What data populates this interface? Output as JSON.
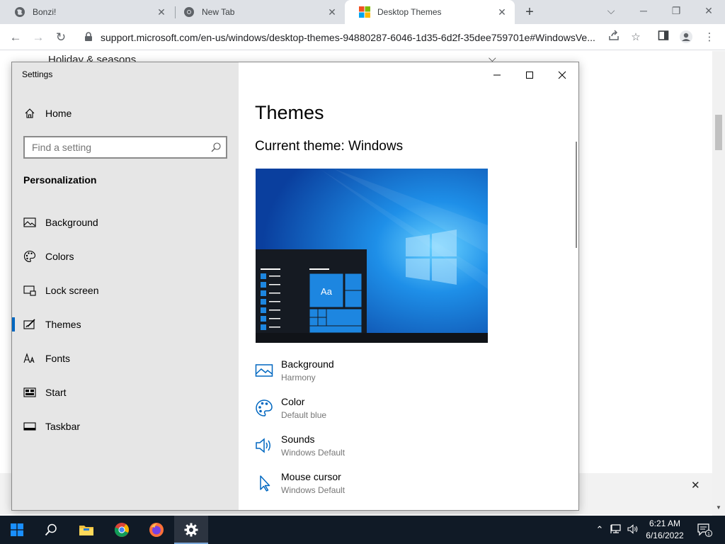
{
  "browser": {
    "tabs": [
      {
        "title": "Bonzi!",
        "icon": "globe-icon"
      },
      {
        "title": "New Tab",
        "icon": "chrome-icon"
      },
      {
        "title": "Desktop Themes",
        "icon": "microsoft-logo-icon",
        "active": true
      }
    ],
    "url": "support.microsoft.com/en-us/windows/desktop-themes-94880287-6046-1d35-6d2f-35dee759701e#WindowsVe..."
  },
  "webpage": {
    "accordion_label": "Holiday & seasons"
  },
  "settings": {
    "window_title": "Settings",
    "home_label": "Home",
    "search_placeholder": "Find a setting",
    "section_heading": "Personalization",
    "nav_items": [
      {
        "label": "Background",
        "icon": "picture-icon"
      },
      {
        "label": "Colors",
        "icon": "palette-icon"
      },
      {
        "label": "Lock screen",
        "icon": "lock-screen-icon"
      },
      {
        "label": "Themes",
        "icon": "paintbrush-icon",
        "selected": true
      },
      {
        "label": "Fonts",
        "icon": "fonts-icon"
      },
      {
        "label": "Start",
        "icon": "start-icon"
      },
      {
        "label": "Taskbar",
        "icon": "taskbar-icon"
      }
    ],
    "content": {
      "title": "Themes",
      "current_theme": "Current theme: Windows",
      "preview_tile_text": "Aa",
      "properties": [
        {
          "label": "Background",
          "value": "Harmony",
          "icon": "picture-icon"
        },
        {
          "label": "Color",
          "value": "Default blue",
          "icon": "palette-icon"
        },
        {
          "label": "Sounds",
          "value": "Windows Default",
          "icon": "speaker-icon"
        },
        {
          "label": "Mouse cursor",
          "value": "Windows Default",
          "icon": "cursor-icon"
        }
      ]
    }
  },
  "taskbar": {
    "time": "6:21 AM",
    "date": "6/16/2022",
    "notification_count": "1"
  },
  "colors": {
    "accent": "#0067c0",
    "taskbar": "#101a26",
    "sidebar": "#e6e6e6"
  }
}
